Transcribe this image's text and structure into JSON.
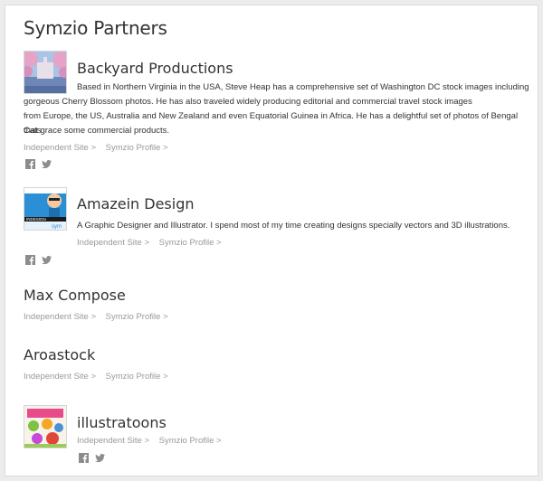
{
  "page": {
    "title": "Symzio Partners"
  },
  "icons": {
    "facebook": "facebook-icon",
    "twitter": "twitter-icon"
  },
  "colors": {
    "text": "#333333",
    "muted": "#999999",
    "icon": "#8c8c8c"
  },
  "partners": [
    {
      "name": "Backyard Productions",
      "description_line1": "Based in Northern Virginia in the USA, Steve Heap has a comprehensive set of Washington DC stock images including",
      "description_line2": "gorgeous Cherry Blossom photos. He has also traveled widely producing editorial and commercial travel stock images",
      "description_line3": "from Europe, the US, Australia and New Zealand and even Equatorial Guinea in Africa. He has a delightful set of photos of Bengal Cats",
      "description_line4": "that grace some commercial products.",
      "independent_site": "Independent Site >",
      "symzio_profile": "Symzio Profile >"
    },
    {
      "name": "Amazein Design",
      "description": "A Graphic Designer and Illustrator. I spend most of my time creating designs specially vectors and 3D illustrations.",
      "independent_site": "Independent Site >",
      "symzio_profile": "Symzio Profile >",
      "thumb_text": "INDESIGN"
    },
    {
      "name": "Max Compose",
      "independent_site": "Independent Site >",
      "symzio_profile": "Symzio Profile >"
    },
    {
      "name": "Aroastock",
      "independent_site": "Independent Site >",
      "symzio_profile": "Symzio Profile >"
    },
    {
      "name": "illustratoons",
      "independent_site": "Independent Site >",
      "symzio_profile": "Symzio Profile >"
    }
  ]
}
